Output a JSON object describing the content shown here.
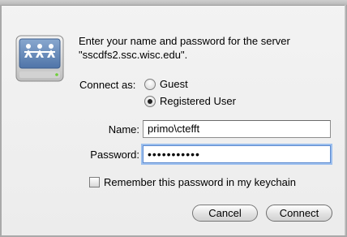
{
  "dialog": {
    "prompt_line1": "Enter your name and password for the server",
    "prompt_line2": "\"sscdfs2.ssc.wisc.edu\"."
  },
  "connect_as": {
    "label": "Connect as:",
    "options": [
      {
        "label": "Guest",
        "selected": false
      },
      {
        "label": "Registered User",
        "selected": true
      }
    ]
  },
  "fields": {
    "name_label": "Name:",
    "name_value": "primo\\ctefft",
    "password_label": "Password:",
    "password_value": "•••••••••••"
  },
  "remember": {
    "label": "Remember this password in my keychain",
    "checked": false
  },
  "buttons": {
    "cancel": "Cancel",
    "connect": "Connect"
  },
  "icon": "network-server-icon"
}
